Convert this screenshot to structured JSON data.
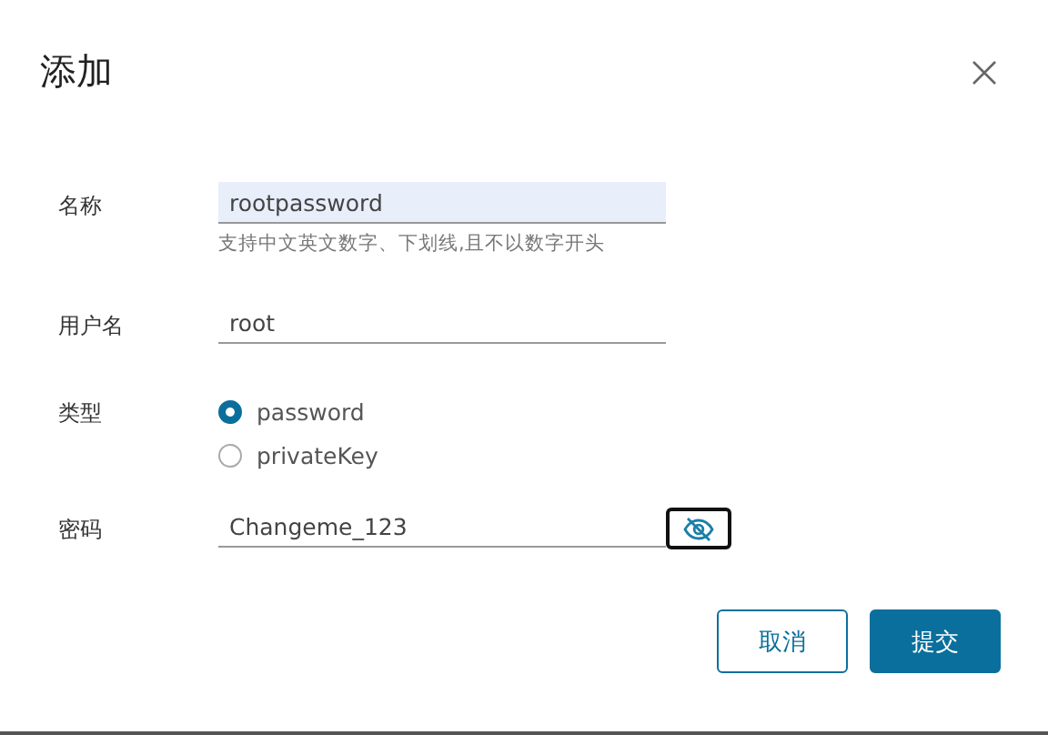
{
  "dialog": {
    "title": "添加"
  },
  "fields": [
    {
      "kind": "text",
      "label": "名称",
      "value": "rootpassword",
      "focused": true,
      "hint": "支持中文英文数字、下划线,且不以数字开头"
    },
    {
      "kind": "text",
      "label": "用户名",
      "value": "root",
      "focused": false
    },
    {
      "kind": "radio",
      "label": "类型",
      "options": [
        {
          "label": "password",
          "selected": true
        },
        {
          "label": "privateKey",
          "selected": false
        }
      ]
    },
    {
      "kind": "password",
      "label": "密码",
      "value": "Changeme_123",
      "focused": false
    }
  ],
  "buttons": [
    {
      "label": "取消",
      "primary": false
    },
    {
      "label": "提交",
      "primary": true
    }
  ]
}
